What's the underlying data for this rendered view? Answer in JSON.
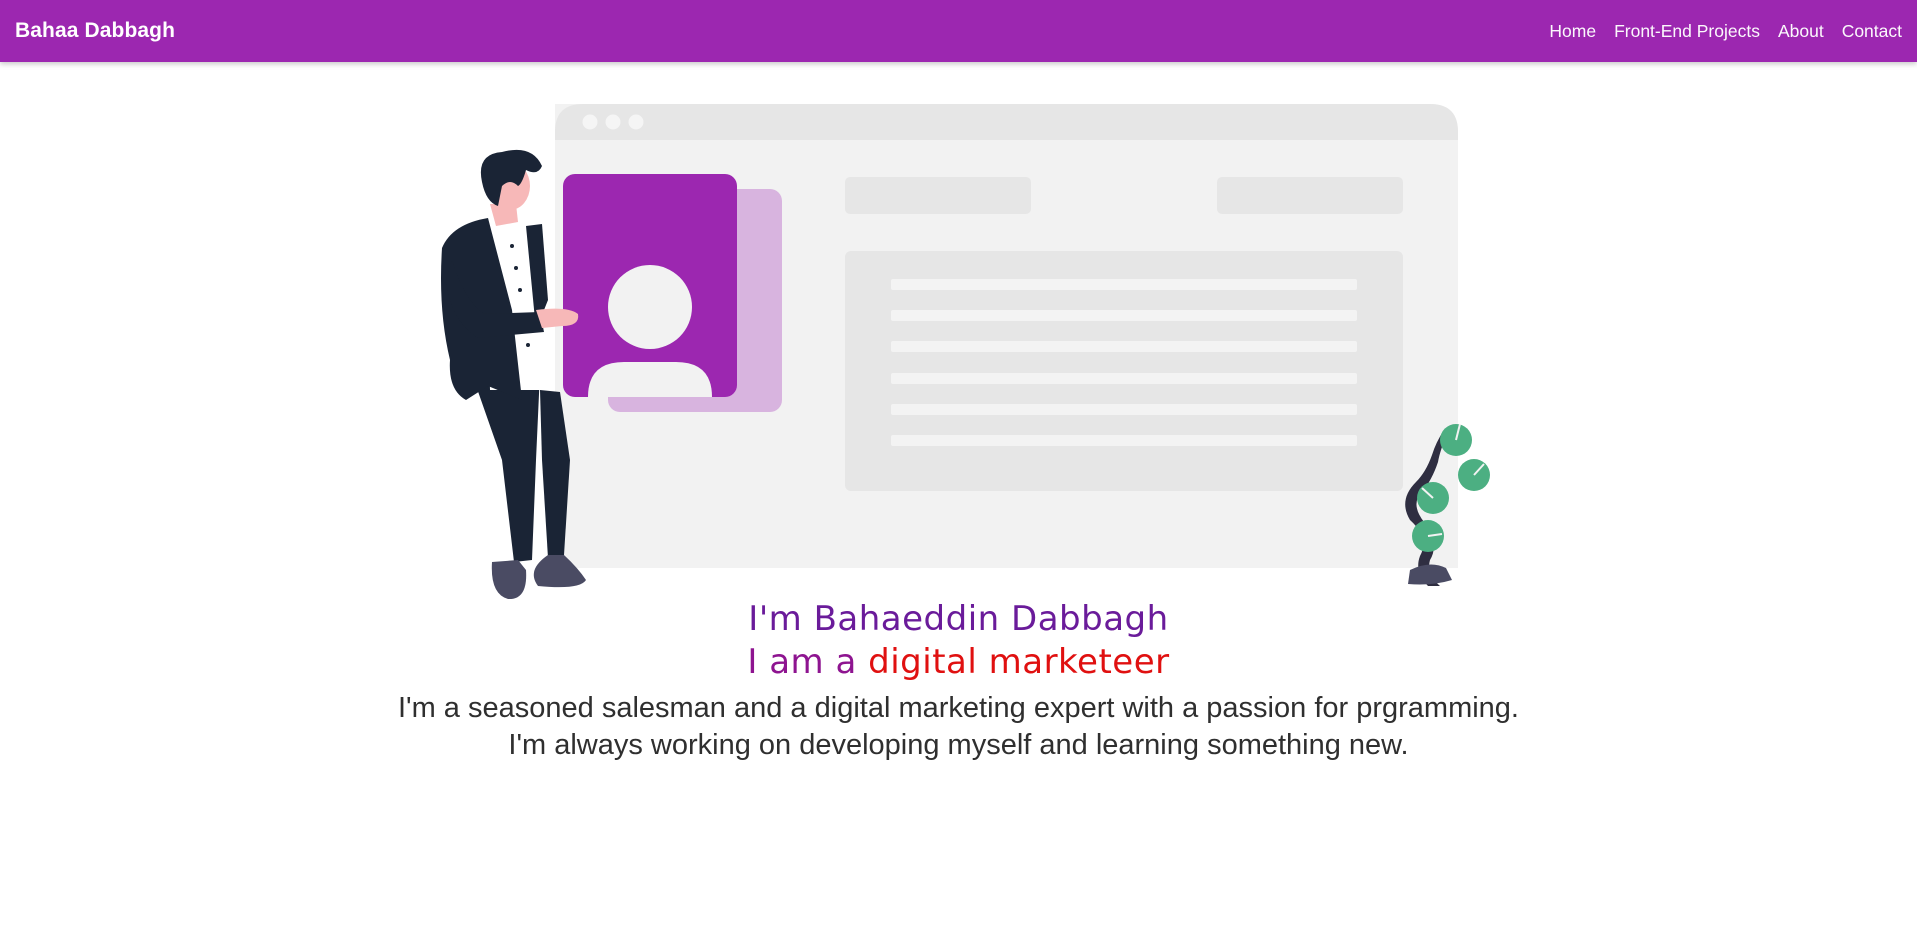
{
  "navbar": {
    "brand": "Bahaa Dabbagh",
    "links": [
      {
        "label": "Home"
      },
      {
        "label": "Front-End Projects"
      },
      {
        "label": "About"
      },
      {
        "label": "Contact"
      }
    ]
  },
  "hero": {
    "illustration_icon": "person-presenting-profile-illustration",
    "headline": "I'm Bahaeddin Dabbagh",
    "subhead_prefix": "I am a ",
    "subhead_role": "digital marketeer",
    "bio_line_1": "I'm a seasoned salesman and a digital marketing expert with a passion for prgramming.",
    "bio_line_2": "I'm always working on developing myself and learning something new."
  },
  "colors": {
    "primary": "#9c27b0",
    "headline": "#6a1b9a",
    "accent_role": "#e01010",
    "body_text": "#2f2f2f",
    "plant": "#4caf82"
  }
}
